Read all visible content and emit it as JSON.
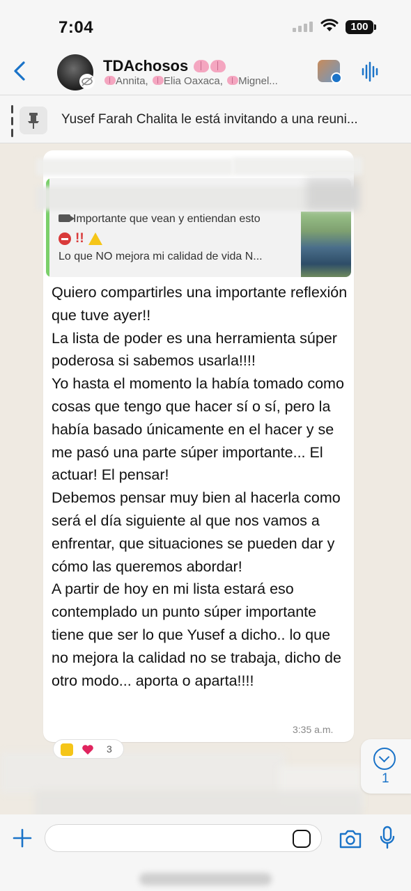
{
  "status_bar": {
    "time": "7:04",
    "battery": "100"
  },
  "header": {
    "back_icon": "chevron-left-icon",
    "group_name": "TDAchosos",
    "members": [
      "Annita,",
      "Elia Oaxaca,",
      "Mignel..."
    ],
    "audio_icon": "audio-wave-icon",
    "accent_color": "#1a73c8"
  },
  "pinned": {
    "icon": "pin-icon",
    "text": "Yusef Farah Chalita le está invitando a una reuni..."
  },
  "quoted_message": {
    "line1": "Importante que vean y entiendan esto",
    "line2": "!!",
    "line3": "Lo que NO mejora mi calidad de vida N...",
    "accent_color": "#7bd06a"
  },
  "message": {
    "text": "Quiero compartirles una importante reflexión que tuve ayer!!\nLa lista de poder es una herramienta súper poderosa si sabemos usarla!!!!\nYo hasta el momento la había tomado como cosas que tengo que hacer sí o sí, pero la había basado únicamente en el hacer y se me pasó una parte súper importante... El actuar! El pensar!\nDebemos pensar muy bien al hacerla como será el día siguiente al que nos vamos a enfrentar, que situaciones se pueden dar y cómo las queremos abordar!\nA partir de hoy en mi lista estará eso contemplado un punto súper importante tiene que ser lo que Yusef a dicho.. lo que no mejora la calidad no se trabaja, dicho de otro modo... aporta o aparta!!!!",
    "time": "3:35 a.m."
  },
  "reactions": {
    "count": "3"
  },
  "scroll_down": {
    "count": "1"
  },
  "composer": {
    "placeholder": ""
  }
}
